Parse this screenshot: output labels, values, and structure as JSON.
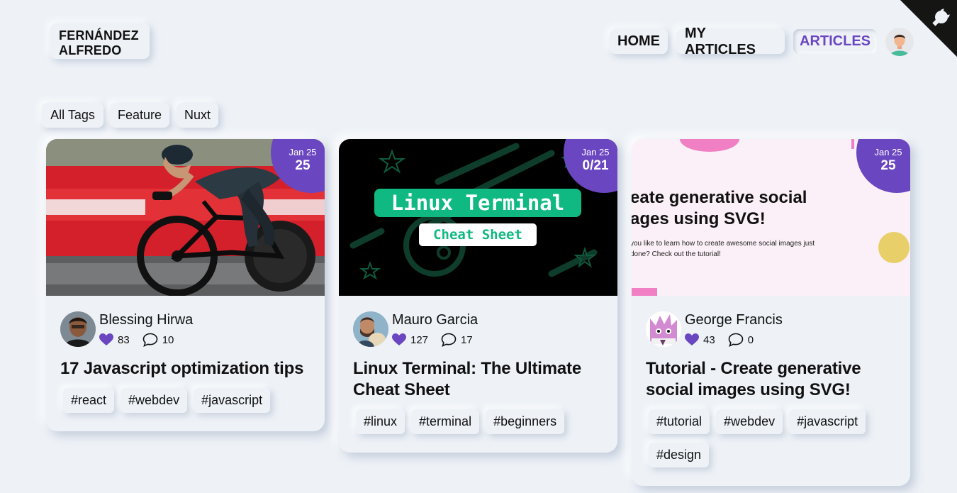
{
  "header": {
    "logo_line1": "FERNÁNDEZ",
    "logo_line2": "ALFREDO",
    "nav": [
      {
        "label": "HOME"
      },
      {
        "label": "MY ARTICLES"
      },
      {
        "label": "ARTICLES",
        "active": true
      }
    ]
  },
  "tag_filters": [
    {
      "label": "All Tags"
    },
    {
      "label": "Feature"
    },
    {
      "label": "Nuxt"
    }
  ],
  "colors": {
    "accent": "#6b46c1",
    "background": "#eef2f7"
  },
  "articles": [
    {
      "date_month": "Jan 25",
      "date_day": "25",
      "author": "Blessing Hirwa",
      "likes": "83",
      "comments": "10",
      "title": "17 Javascript optimization tips",
      "tags": [
        "#react",
        "#webdev",
        "#javascript"
      ]
    },
    {
      "date_month": "Jan 25",
      "date_day": "0/21",
      "author": "Mauro Garcia",
      "likes": "127",
      "comments": "17",
      "title": "Linux Terminal: The Ultimate Cheat Sheet",
      "tags": [
        "#linux",
        "#terminal",
        "#beginners"
      ],
      "cover_title": "Linux Terminal",
      "cover_subtitle": "Cheat Sheet"
    },
    {
      "date_month": "Jan 25",
      "date_day": "25",
      "author": "George Francis",
      "likes": "43",
      "comments": "0",
      "title": "Tutorial - Create generative social images using SVG!",
      "tags": [
        "#tutorial",
        "#webdev",
        "#javascript",
        "#design"
      ],
      "cover_title_line1": "eate generative social",
      "cover_title_line2": "ages using SVG!",
      "cover_text_line1": "you like to learn how to create awesome social images just",
      "cover_text_line2": "done? Check out the tutorial!"
    }
  ]
}
